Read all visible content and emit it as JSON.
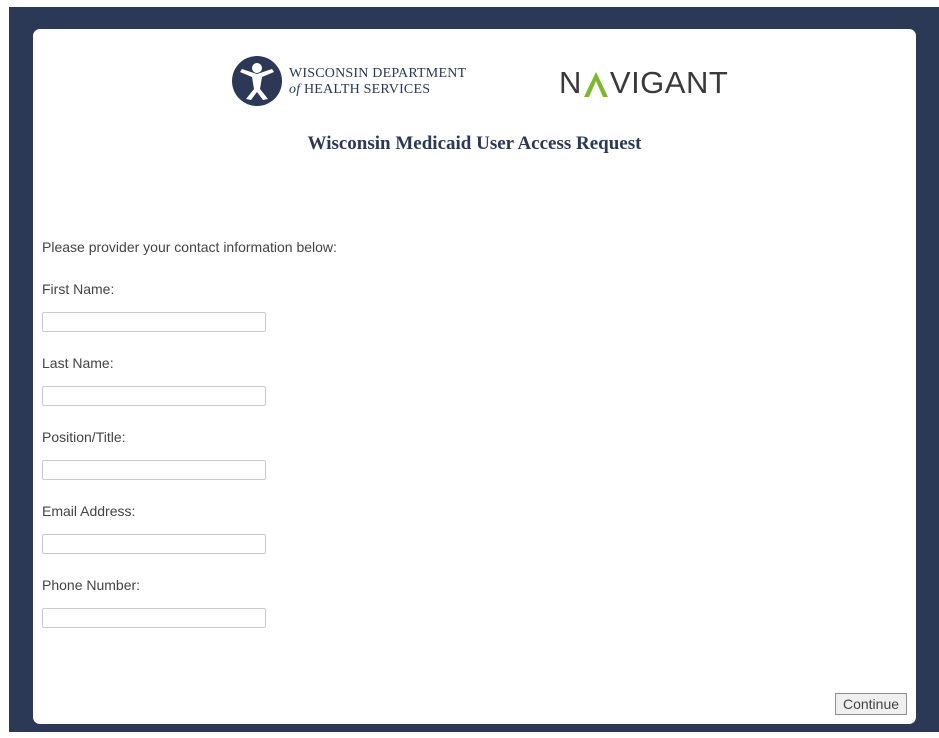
{
  "colors": {
    "frame_background": "#2b3856",
    "card_background": "#ffffff",
    "title_color": "#2b3856",
    "navigant_accent_green": "#7ab929",
    "label_color": "#444444"
  },
  "header": {
    "dhs_logo": {
      "icon": "dhs-emblem-icon",
      "line1": "WISCONSIN DEPARTMENT",
      "line2_italic": "of",
      "line2_rest": " HEALTH SERVICES"
    },
    "navigant_logo": {
      "pre": "N",
      "icon": "navigant-a-chevron-icon",
      "post": "VIGANT"
    },
    "title": "Wisconsin Medicaid User Access Request"
  },
  "form": {
    "instructions": "Please provider your contact information below:",
    "fields": [
      {
        "label": "First Name:",
        "value": ""
      },
      {
        "label": "Last Name:",
        "value": ""
      },
      {
        "label": "Position/Title:",
        "value": ""
      },
      {
        "label": "Email Address:",
        "value": ""
      },
      {
        "label": "Phone Number:",
        "value": ""
      }
    ],
    "continue_label": "Continue"
  }
}
